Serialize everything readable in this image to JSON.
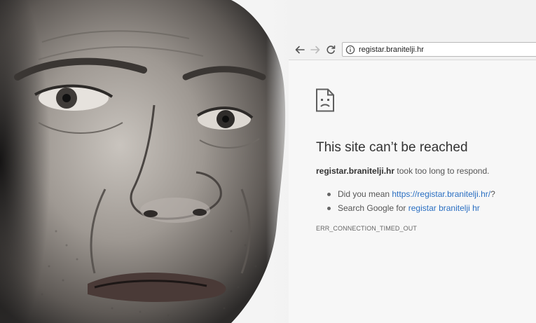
{
  "browser": {
    "url": "registar.branitelji.hr",
    "icons": {
      "back": "arrow-left-icon",
      "forward": "arrow-right-icon",
      "reload": "reload-icon",
      "info": "info-icon"
    }
  },
  "error_page": {
    "icon": "sad-document-icon",
    "title": "This site can’t be reached",
    "host": "registar.branitelji.hr",
    "summary_suffix": " took too long to respond.",
    "suggestion_1_prefix": "Did you mean ",
    "suggestion_1_link": "https://registar.branitelji.hr/",
    "suggestion_1_suffix": "?",
    "suggestion_2_prefix": "Search Google for ",
    "suggestion_2_link": "registar branitelji hr",
    "error_code": "ERR_CONNECTION_TIMED_OUT"
  },
  "photo": {
    "subject": "man-face-photo"
  }
}
